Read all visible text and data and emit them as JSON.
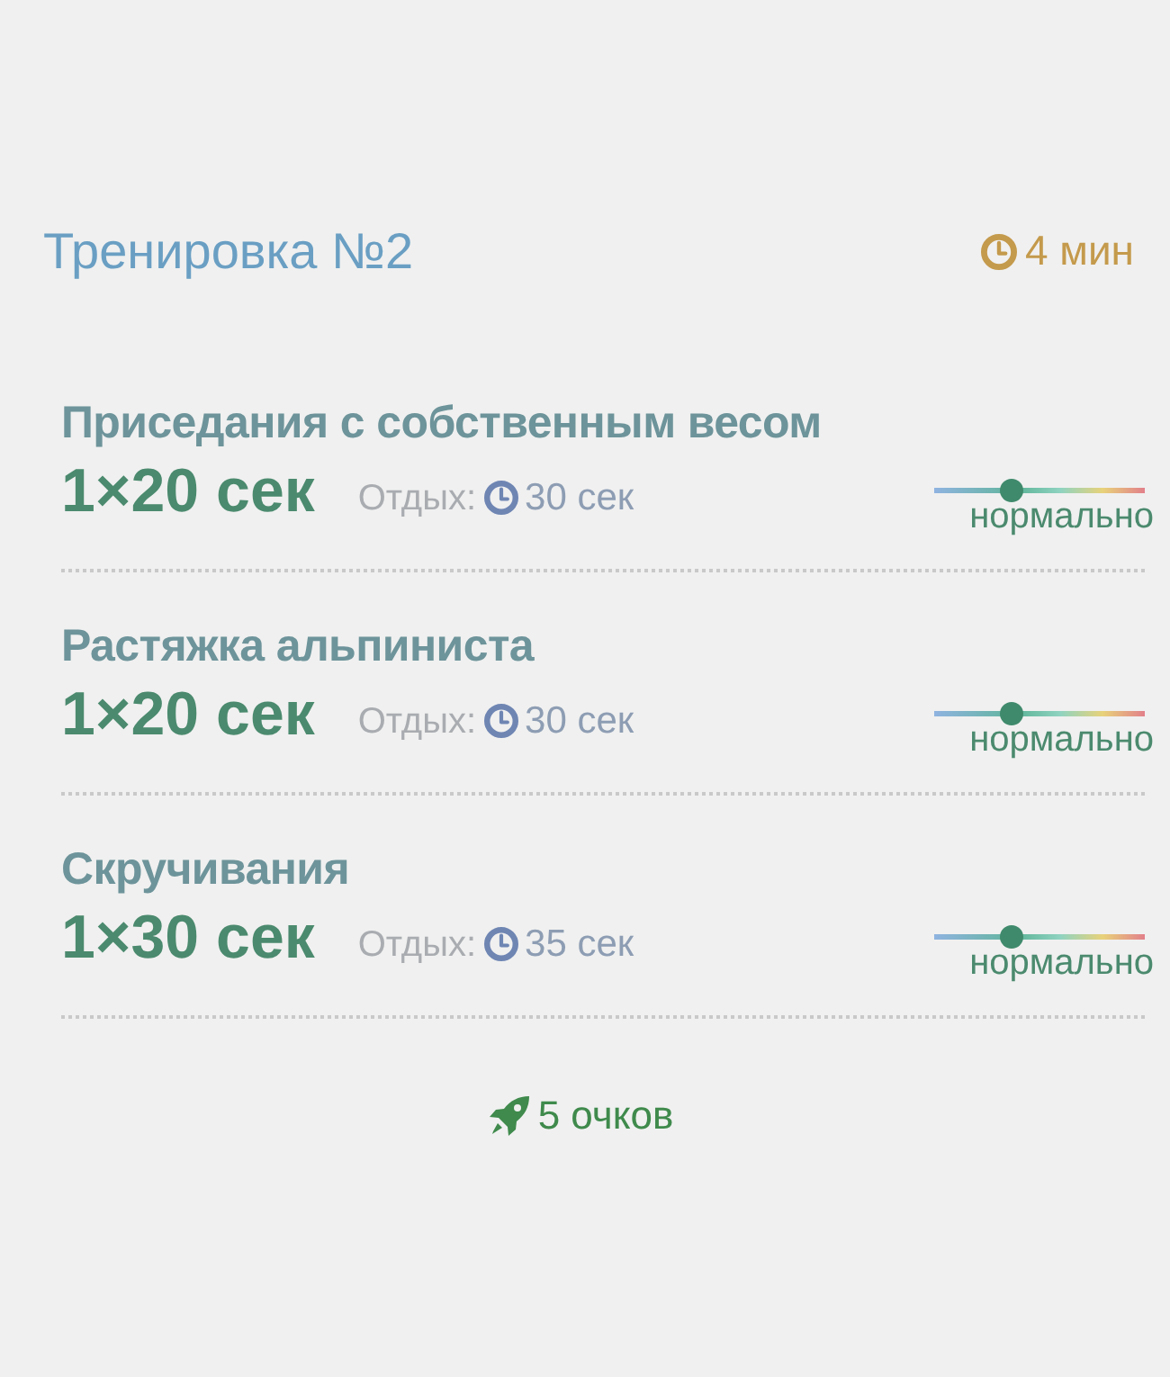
{
  "workout": {
    "title": "Тренировка №2",
    "duration": "4 мин"
  },
  "exercises": [
    {
      "name": "Приседания с собственным весом",
      "sets": "1×20 сек",
      "rest_label": "Отдых:",
      "rest": "30 сек",
      "intensity": {
        "level": 0.37,
        "label": "нормально"
      }
    },
    {
      "name": "Растяжка альпиниста",
      "sets": "1×20 сек",
      "rest_label": "Отдых:",
      "rest": "30 сек",
      "intensity": {
        "level": 0.37,
        "label": "нормально"
      }
    },
    {
      "name": "Скручивания",
      "sets": "1×30 сек",
      "rest_label": "Отдых:",
      "rest": "35 сек",
      "intensity": {
        "level": 0.37,
        "label": "нормально"
      }
    }
  ],
  "points": "5 очков"
}
